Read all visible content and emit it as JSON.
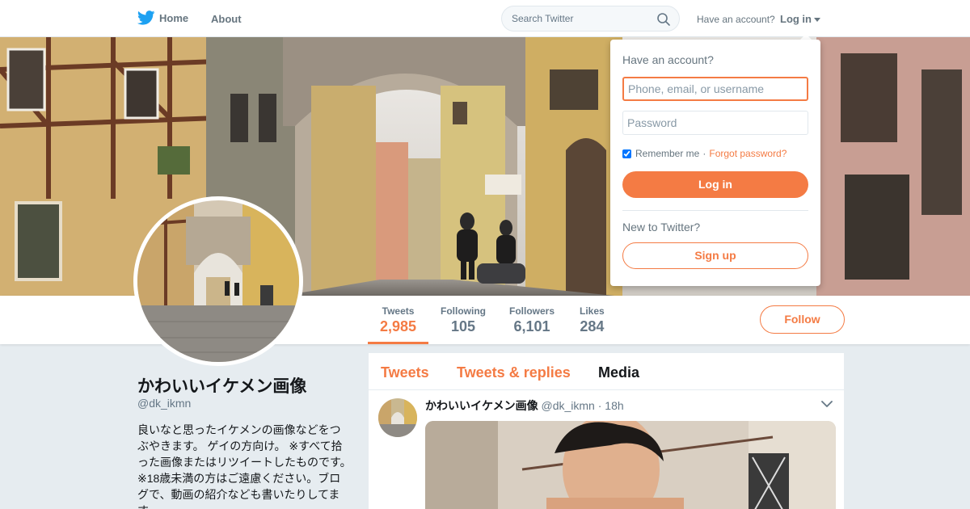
{
  "topbar": {
    "home_label": "Home",
    "about_label": "About",
    "search_placeholder": "Search Twitter",
    "have_account_text": "Have an account?",
    "login_label": "Log in"
  },
  "stats": [
    {
      "label": "Tweets",
      "value": "2,985"
    },
    {
      "label": "Following",
      "value": "105"
    },
    {
      "label": "Followers",
      "value": "6,101"
    },
    {
      "label": "Likes",
      "value": "284"
    }
  ],
  "follow_label": "Follow",
  "profile": {
    "name": "かわいいイケメン画像",
    "handle": "@dk_ikmn",
    "bio": "良いなと思ったイケメンの画像などをつぶやきます。 ゲイの方向け。 ※すべて拾った画像またはリツイートしたものです。※18歳未満の方はご遠慮ください。ブログで、動画の紹介なども書いたりしてます。"
  },
  "tabs": [
    {
      "label": "Tweets"
    },
    {
      "label": "Tweets & replies"
    },
    {
      "label": "Media"
    }
  ],
  "tweet": {
    "name": "かわいいイケメン画像",
    "handle": "@dk_ikmn",
    "separator": "·",
    "time": "18h"
  },
  "login_dropdown": {
    "title": "Have an account?",
    "username_placeholder": "Phone, email, or username",
    "password_placeholder": "Password",
    "remember_label": "Remember me",
    "separator": "·",
    "forgot_label": "Forgot password?",
    "login_button": "Log in",
    "new_text": "New to Twitter?",
    "signup_button": "Sign up"
  },
  "colors": {
    "accent": "#f47b44",
    "twitter_blue": "#1da1f2",
    "text_secondary": "#657786"
  }
}
